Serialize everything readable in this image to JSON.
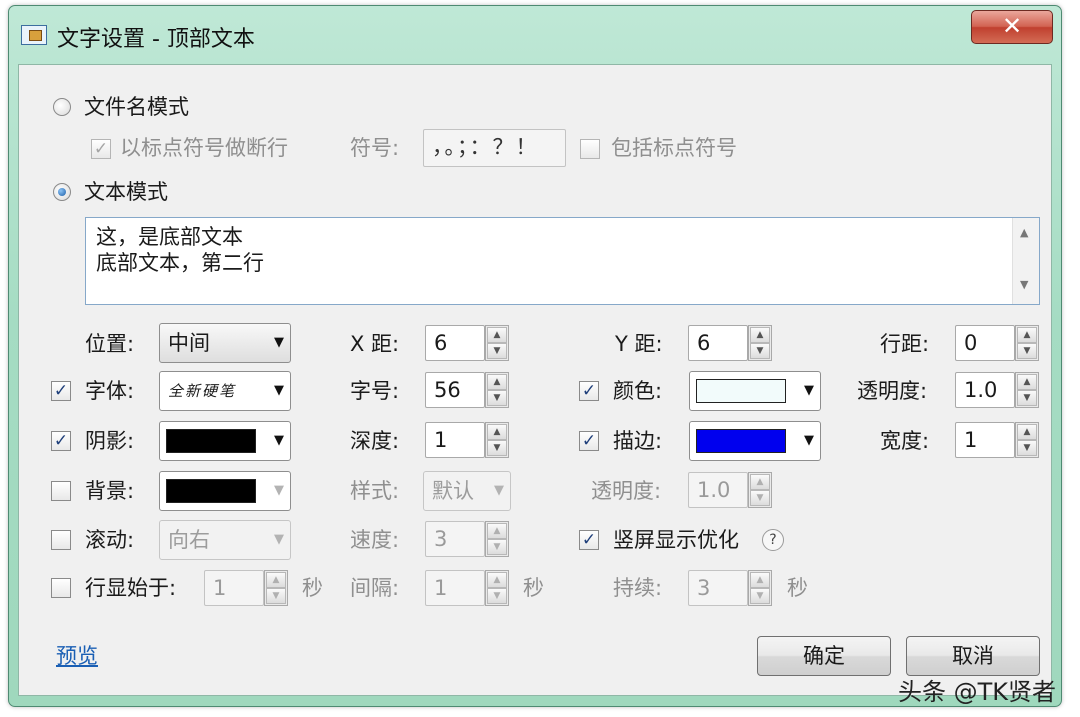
{
  "window": {
    "title": "文字设置 - 顶部文本",
    "close_glyph": "✕"
  },
  "filename_mode": {
    "label": "文件名模式",
    "punct_break_label": "以标点符号做断行",
    "symbols_label": "符号:",
    "symbols_value": "，。；：？！",
    "include_punct_label": "包括标点符号"
  },
  "text_mode": {
    "label": "文本模式",
    "line1": "这，是底部文本",
    "line2": "底部文本，第二行"
  },
  "row1": {
    "position_label": "位置:",
    "position_value": "中间",
    "x_label": "X 距:",
    "x_value": "6",
    "y_label": "Y 距:",
    "y_value": "6",
    "linegap_label": "行距:",
    "linegap_value": "0"
  },
  "row2": {
    "font_label": "字体:",
    "font_preview": "全新硬笔",
    "size_label": "字号:",
    "size_value": "56",
    "color_label": "颜色:",
    "color_hex": "#f2fbfb",
    "opacity_label": "透明度:",
    "opacity_value": "1.0"
  },
  "row3": {
    "shadow_label": "阴影:",
    "shadow_color": "#000000",
    "depth_label": "深度:",
    "depth_value": "1",
    "stroke_label": "描边:",
    "stroke_color": "#0000ee",
    "width_label": "宽度:",
    "width_value": "1"
  },
  "row4": {
    "bg_label": "背景:",
    "bg_color": "#000000",
    "style_label": "样式:",
    "style_value": "默认",
    "bg_opacity_label": "透明度:",
    "bg_opacity_value": "1.0"
  },
  "row5": {
    "scroll_label": "滚动:",
    "scroll_value": "向右",
    "speed_label": "速度:",
    "speed_value": "3",
    "vertical_opt_label": "竖屏显示优化",
    "help_glyph": "?"
  },
  "row6": {
    "start_label": "行显始于:",
    "start_value": "1",
    "start_unit": "秒",
    "interval_label": "间隔:",
    "interval_value": "1",
    "interval_unit": "秒",
    "duration_label": "持续:",
    "duration_value": "3",
    "duration_unit": "秒"
  },
  "footer": {
    "preview_link": "预览",
    "ok_label": "确定",
    "cancel_label": "取消"
  },
  "watermark": "头条 @TK贤者"
}
